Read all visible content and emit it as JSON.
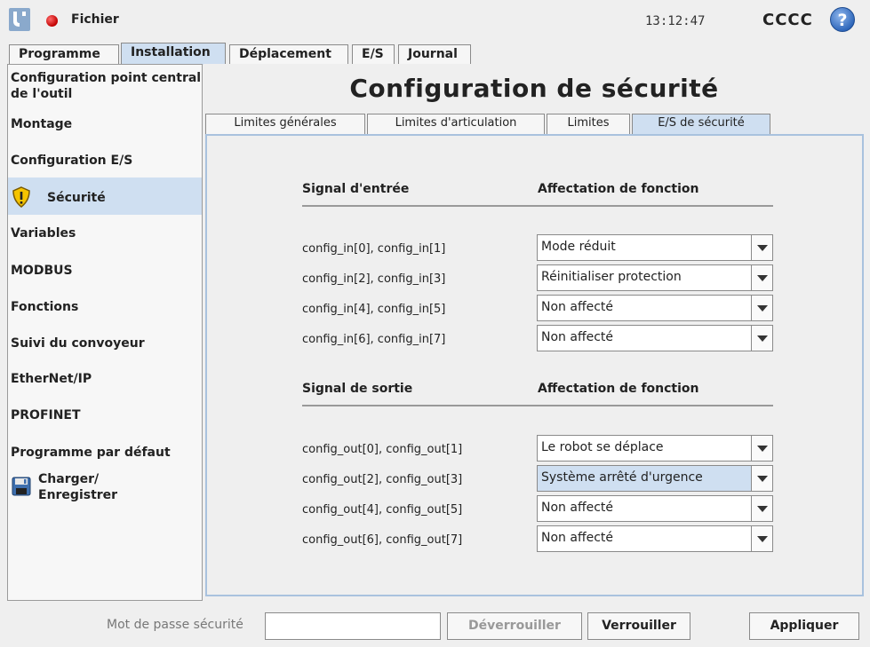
{
  "header": {
    "menu_label": "Fichier",
    "time": "13:12:47",
    "robot_name": "CCCC",
    "help_symbol": "?"
  },
  "main_tabs": [
    {
      "label": "Programme"
    },
    {
      "label": "Installation",
      "active": true
    },
    {
      "label": "Déplacement"
    },
    {
      "label": "E/S"
    },
    {
      "label": "Journal"
    }
  ],
  "sidebar": {
    "items": [
      {
        "label": "Configuration point central de l'outil",
        "icon": null
      },
      {
        "label": "Montage",
        "icon": null
      },
      {
        "label": "Configuration E/S",
        "icon": null
      },
      {
        "label": "Sécurité",
        "icon": "warning-shield-icon",
        "selected": true
      },
      {
        "label": "Variables",
        "icon": null
      },
      {
        "label": "MODBUS",
        "icon": null
      },
      {
        "label": "Fonctions",
        "icon": null
      },
      {
        "label": "Suivi du convoyeur",
        "icon": null
      },
      {
        "label": "EtherNet/IP",
        "icon": null
      },
      {
        "label": "PROFINET",
        "icon": null
      },
      {
        "label": "Programme par défaut",
        "icon": null
      },
      {
        "label": "Charger/ Enregistrer",
        "icon": "floppy-disk-icon"
      }
    ]
  },
  "page": {
    "title": "Configuration de sécurité",
    "sub_tabs": [
      {
        "label": "Limites générales"
      },
      {
        "label": "Limites d'articulation"
      },
      {
        "label": "Limites"
      },
      {
        "label": "E/S de sécurité",
        "active": true
      }
    ]
  },
  "inputs_section": {
    "signal_header": "Signal d'entrée",
    "function_header": "Affectation de fonction",
    "rows": [
      {
        "signal": "config_in[0], config_in[1]",
        "function": "Mode réduit"
      },
      {
        "signal": "config_in[2], config_in[3]",
        "function": "Réinitialiser protection"
      },
      {
        "signal": "config_in[4], config_in[5]",
        "function": "Non affecté"
      },
      {
        "signal": "config_in[6], config_in[7]",
        "function": "Non affecté"
      }
    ]
  },
  "outputs_section": {
    "signal_header": "Signal de sortie",
    "function_header": "Affectation de fonction",
    "rows": [
      {
        "signal": "config_out[0], config_out[1]",
        "function": "Le robot se déplace"
      },
      {
        "signal": "config_out[2], config_out[3]",
        "function": "Système arrêté d'urgence",
        "highlighted": true
      },
      {
        "signal": "config_out[4], config_out[5]",
        "function": "Non affecté"
      },
      {
        "signal": "config_out[6], config_out[7]",
        "function": "Non affecté"
      }
    ]
  },
  "footer": {
    "password_label": "Mot de passe sécurité",
    "password_value": "",
    "unlock_label": "Déverrouiller",
    "lock_label": "Verrouiller",
    "apply_label": "Appliquer"
  },
  "colors": {
    "selected_bg": "#cfdff1",
    "panel_border": "#a9c2de",
    "record_dot": "#d40000",
    "help_blue": "#2a63b8",
    "warning_yellow": "#f5c400"
  }
}
